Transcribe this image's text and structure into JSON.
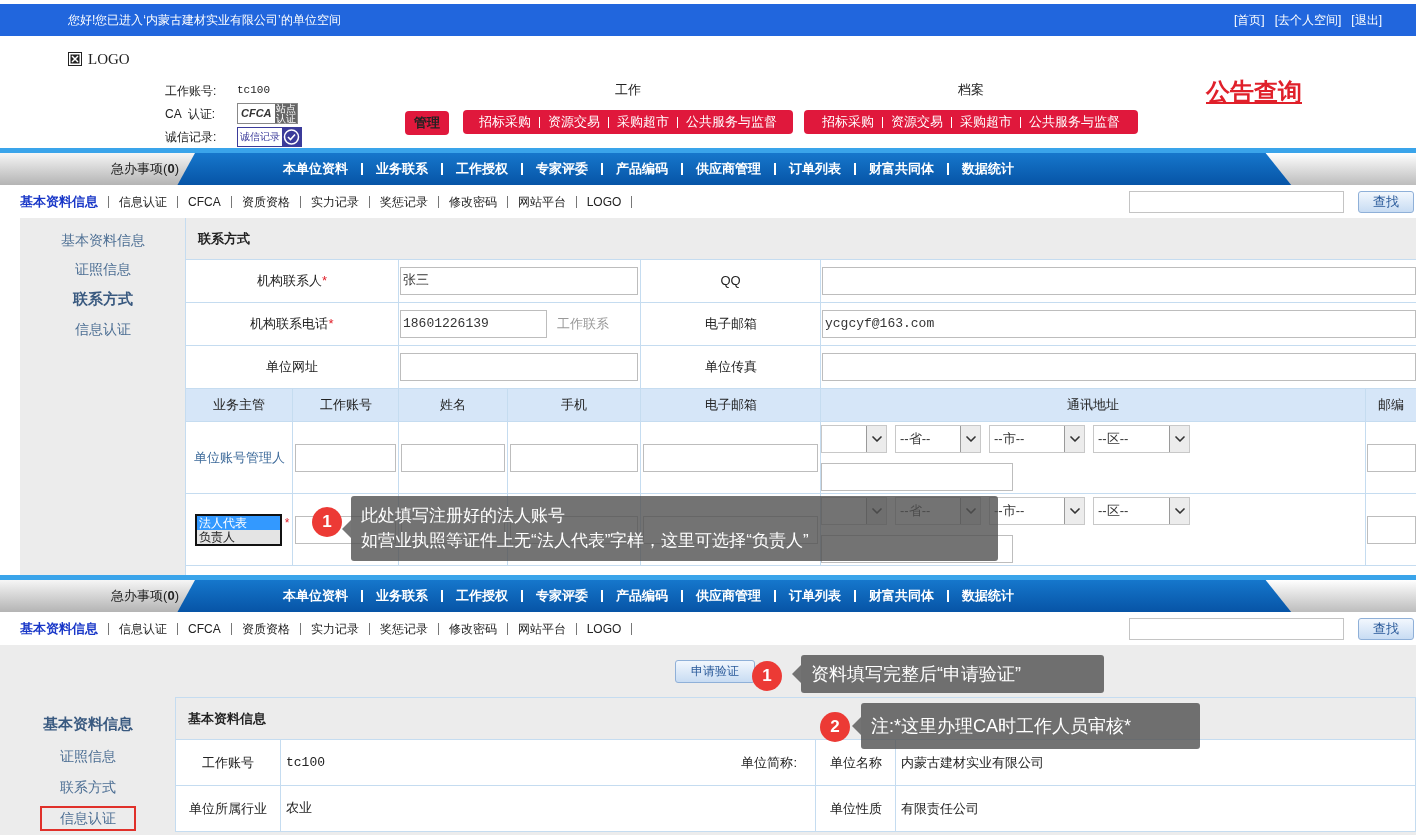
{
  "top_bar": {
    "greeting": "您好!您已进入‘内蒙古建材实业有限公司’的单位空间",
    "links": [
      "[首页]",
      "[去个人空间]",
      "[退出]"
    ]
  },
  "header": {
    "logo": "LOGO",
    "account": [
      {
        "kind": "text",
        "label": "工作账号:",
        "value": "tc100"
      },
      {
        "kind": "ca_badge",
        "label": "CA  认证:",
        "badge": "CFCA",
        "badge_side": "站点认证"
      },
      {
        "kind": "credit_badge",
        "label": "诚信记录:",
        "badge": "诚信记录"
      }
    ],
    "manage": "管理",
    "groups": [
      {
        "title": "工作",
        "links": [
          "招标采购",
          "资源交易",
          "采购超市",
          "公共服务与监督"
        ]
      },
      {
        "title": "档案",
        "links": [
          "招标采购",
          "资源交易",
          "采购超市",
          "公共服务与监督"
        ]
      }
    ],
    "notice": "公告查询"
  },
  "screen_1": {
    "nav": {
      "urgent": "急办事项(**0**)",
      "items": [
        "本单位资料",
        "业务联系",
        "工作授权",
        "专家评委",
        "产品编码",
        "供应商管理",
        "订单列表",
        "财富共同体",
        "数据统计"
      ]
    },
    "subnav": [
      {
        "label": "基本资料信息",
        "selected": true
      },
      {
        "label": "信息认证",
        "selected": false
      },
      {
        "label": "CFCA",
        "selected": false
      },
      {
        "label": "资质资格",
        "selected": false
      },
      {
        "label": "实力记录",
        "selected": false
      },
      {
        "label": "奖惩记录",
        "selected": false
      },
      {
        "label": "修改密码",
        "selected": false
      },
      {
        "label": "网站平台",
        "selected": false
      },
      {
        "label": "LOGO",
        "selected": false
      }
    ],
    "search_button": "查找",
    "sidebar": [
      {
        "label": "基本资料信息",
        "selected": false
      },
      {
        "label": "证照信息",
        "selected": false
      },
      {
        "label": "联系方式",
        "selected": true
      },
      {
        "label": "信息认证",
        "selected": false
      }
    ],
    "section_title": "联系方式",
    "form_rows": [
      {
        "left": {
          "label": "机构联系人",
          "required_mark": "*",
          "value": "张三"
        },
        "right": {
          "label": "QQ"
        }
      },
      {
        "left": {
          "label": "机构联系电话",
          "required_mark": "*",
          "value": "18601226139",
          "hint": "工作联系"
        },
        "right": {
          "label": "电子邮箱",
          "value": "ycgcyf@163.com"
        }
      },
      {
        "left": {
          "label": "单位网址"
        },
        "right": {
          "label": "单位传真"
        }
      }
    ],
    "columns": [
      "业务主管",
      "工作账号",
      "姓名",
      "手机",
      "电子邮箱",
      "通讯地址",
      "邮编"
    ],
    "people": [
      {
        "kind": "text",
        "role": "单位账号管理人",
        "selects": [
          "--省--",
          "--市--",
          "--区--"
        ]
      },
      {
        "kind": "listbox",
        "options": [
          {
            "label": "法人代表",
            "selected": true
          },
          {
            "label": "负责人",
            "selected": false
          }
        ],
        "required_mark": "*",
        "selects": [
          "--省--",
          "--市--",
          "--区--"
        ]
      }
    ],
    "callout": {
      "step": "1",
      "lines": [
        "此处填写注册好的法人账号",
        "如营业执照等证件上无“法人代表”字样，这里可选择“负责人”"
      ]
    }
  },
  "screen_2": {
    "nav": {
      "urgent": "急办事项(**0**)",
      "items": [
        "本单位资料",
        "业务联系",
        "工作授权",
        "专家评委",
        "产品编码",
        "供应商管理",
        "订单列表",
        "财富共同体",
        "数据统计"
      ]
    },
    "subnav": [
      {
        "label": "基本资料信息",
        "selected": true
      },
      {
        "label": "信息认证",
        "selected": false
      },
      {
        "label": "CFCA",
        "selected": false
      },
      {
        "label": "资质资格",
        "selected": false
      },
      {
        "label": "实力记录",
        "selected": false
      },
      {
        "label": "奖惩记录",
        "selected": false
      },
      {
        "label": "修改密码",
        "selected": false
      },
      {
        "label": "网站平台",
        "selected": false
      },
      {
        "label": "LOGO",
        "selected": false
      }
    ],
    "search_button": "查找",
    "apply_button": "申请验证",
    "sidebar": [
      {
        "label": "基本资料信息",
        "selected": true,
        "highlighted": false
      },
      {
        "label": "证照信息",
        "selected": false,
        "highlighted": false
      },
      {
        "label": "联系方式",
        "selected": false,
        "highlighted": false
      },
      {
        "label": "信息认证",
        "selected": false,
        "highlighted": true
      }
    ],
    "section_title": "基本资料信息",
    "rows": [
      {
        "label": "工作账号",
        "value": "tc100",
        "side_label": "单位简称:",
        "label_2": "单位名称",
        "value_2": "内蒙古建材实业有限公司"
      },
      {
        "label": "单位所属行业",
        "value": "农业",
        "label_2": "单位性质",
        "value_2": "有限责任公司"
      }
    ],
    "callouts": [
      {
        "step": "1",
        "lines": [
          "资料填写完整后“申请验证”"
        ]
      },
      {
        "step": "2",
        "lines": [
          "注:*这里办理CA时工作人员审核*"
        ]
      }
    ]
  }
}
